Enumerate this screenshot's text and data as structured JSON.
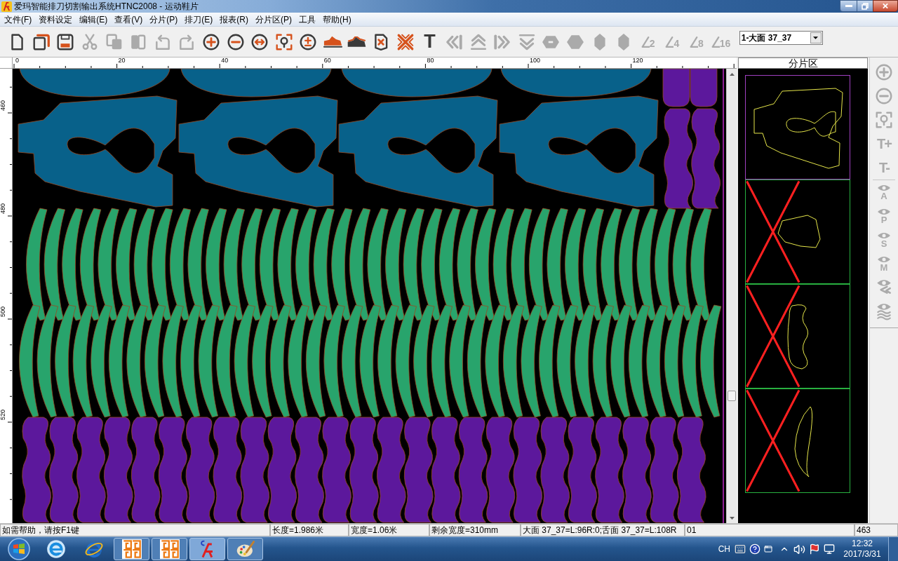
{
  "window": {
    "title": "爱玛智能排刀切割输出系统HTNC2008 - 运动鞋片"
  },
  "menu": [
    {
      "label": "文件(F)"
    },
    {
      "label": "资料设定"
    },
    {
      "label": "编辑(E)"
    },
    {
      "label": "查看(V)"
    },
    {
      "label": "分片(P)"
    },
    {
      "label": "排刀(E)"
    },
    {
      "label": "报表(R)"
    },
    {
      "label": "分片区(P)"
    },
    {
      "label": "工具"
    },
    {
      "label": "帮助(H)"
    }
  ],
  "toolbar": [
    {
      "kind": "new",
      "disabled": false
    },
    {
      "kind": "open",
      "disabled": false
    },
    {
      "kind": "save",
      "disabled": false
    },
    {
      "kind": "cut",
      "disabled": true
    },
    {
      "kind": "copy",
      "disabled": true
    },
    {
      "kind": "paste",
      "disabled": true
    },
    {
      "kind": "undo",
      "disabled": true
    },
    {
      "kind": "redo",
      "disabled": true
    },
    {
      "kind": "zoom_in",
      "disabled": false
    },
    {
      "kind": "zoom_out",
      "disabled": false
    },
    {
      "kind": "fit_width",
      "disabled": false
    },
    {
      "kind": "zoom_area",
      "disabled": false
    },
    {
      "kind": "plus_minus",
      "disabled": false
    },
    {
      "kind": "shoe",
      "disabled": false
    },
    {
      "kind": "shoe_outline",
      "disabled": false
    },
    {
      "kind": "tag_x",
      "disabled": false
    },
    {
      "kind": "cross_pattern",
      "disabled": false
    },
    {
      "kind": "text",
      "label": "T",
      "disabled": false
    },
    {
      "kind": "first",
      "disabled": true
    },
    {
      "kind": "up",
      "disabled": true
    },
    {
      "kind": "last",
      "disabled": true
    },
    {
      "kind": "down",
      "disabled": true
    },
    {
      "kind": "hex_minus",
      "disabled": true
    },
    {
      "kind": "hex",
      "disabled": true
    },
    {
      "kind": "diamond",
      "disabled": true
    },
    {
      "kind": "diamond",
      "disabled": true
    },
    {
      "kind": "angle",
      "label": "2",
      "disabled": true
    },
    {
      "kind": "angle",
      "label": "4",
      "disabled": true
    },
    {
      "kind": "angle",
      "label": "8",
      "disabled": true
    },
    {
      "kind": "angle",
      "label": "16",
      "disabled": true
    }
  ],
  "piece_select": {
    "value": "1-大面 37_37"
  },
  "rulers": {
    "x_labels": [
      "0",
      "20",
      "40",
      "60",
      "80",
      "100",
      "120"
    ],
    "y_labels": [
      "460",
      "480",
      "500",
      "520"
    ]
  },
  "panel": {
    "title": "分片区",
    "cards": [
      {
        "kind": "cutout",
        "selected": true,
        "crossed": false
      },
      {
        "kind": "blob",
        "selected": false,
        "crossed": true
      },
      {
        "kind": "scallop",
        "selected": false,
        "crossed": true
      },
      {
        "kind": "crescent",
        "selected": false,
        "crossed": true
      }
    ]
  },
  "side_toolbar": [
    {
      "kind": "zoom_in",
      "disabled": true
    },
    {
      "kind": "zoom_out",
      "disabled": true
    },
    {
      "kind": "zoom_area",
      "disabled": true
    },
    {
      "kind": "text_size",
      "label": "T+",
      "disabled": true
    },
    {
      "kind": "text_size",
      "label": "T-",
      "disabled": true
    },
    {
      "kind": "eye",
      "label": "A",
      "disabled": true
    },
    {
      "kind": "eye",
      "label": "P",
      "disabled": true
    },
    {
      "kind": "eye",
      "label": "S",
      "disabled": true
    },
    {
      "kind": "eye",
      "label": "M",
      "disabled": true
    },
    {
      "kind": "eye_chevrons",
      "disabled": true
    },
    {
      "kind": "eye_waves",
      "disabled": true
    }
  ],
  "status_bar": [
    {
      "text": "如需帮助，请按F1键"
    },
    {
      "text": "长度=1.986米"
    },
    {
      "text": "宽度=1.06米"
    },
    {
      "text": "剩余宽度=310mm"
    },
    {
      "text": "大面 37_37=L:96R:0;舌面 37_37=L:108R"
    },
    {
      "text": "01"
    },
    {
      "text": "463"
    }
  ],
  "taskbar": {
    "apps": [
      {
        "kind": "ie",
        "running": false,
        "selected": false
      },
      {
        "kind": "ie_classic",
        "running": false,
        "selected": false
      },
      {
        "kind": "pattern",
        "running": true,
        "selected": false
      },
      {
        "kind": "pattern",
        "running": true,
        "selected": false
      },
      {
        "kind": "cad",
        "running": true,
        "selected": true
      },
      {
        "kind": "paint",
        "running": true,
        "selected": false
      }
    ],
    "tray": {
      "language": "CH",
      "time": "12:32",
      "date": "2017/3/31"
    }
  }
}
